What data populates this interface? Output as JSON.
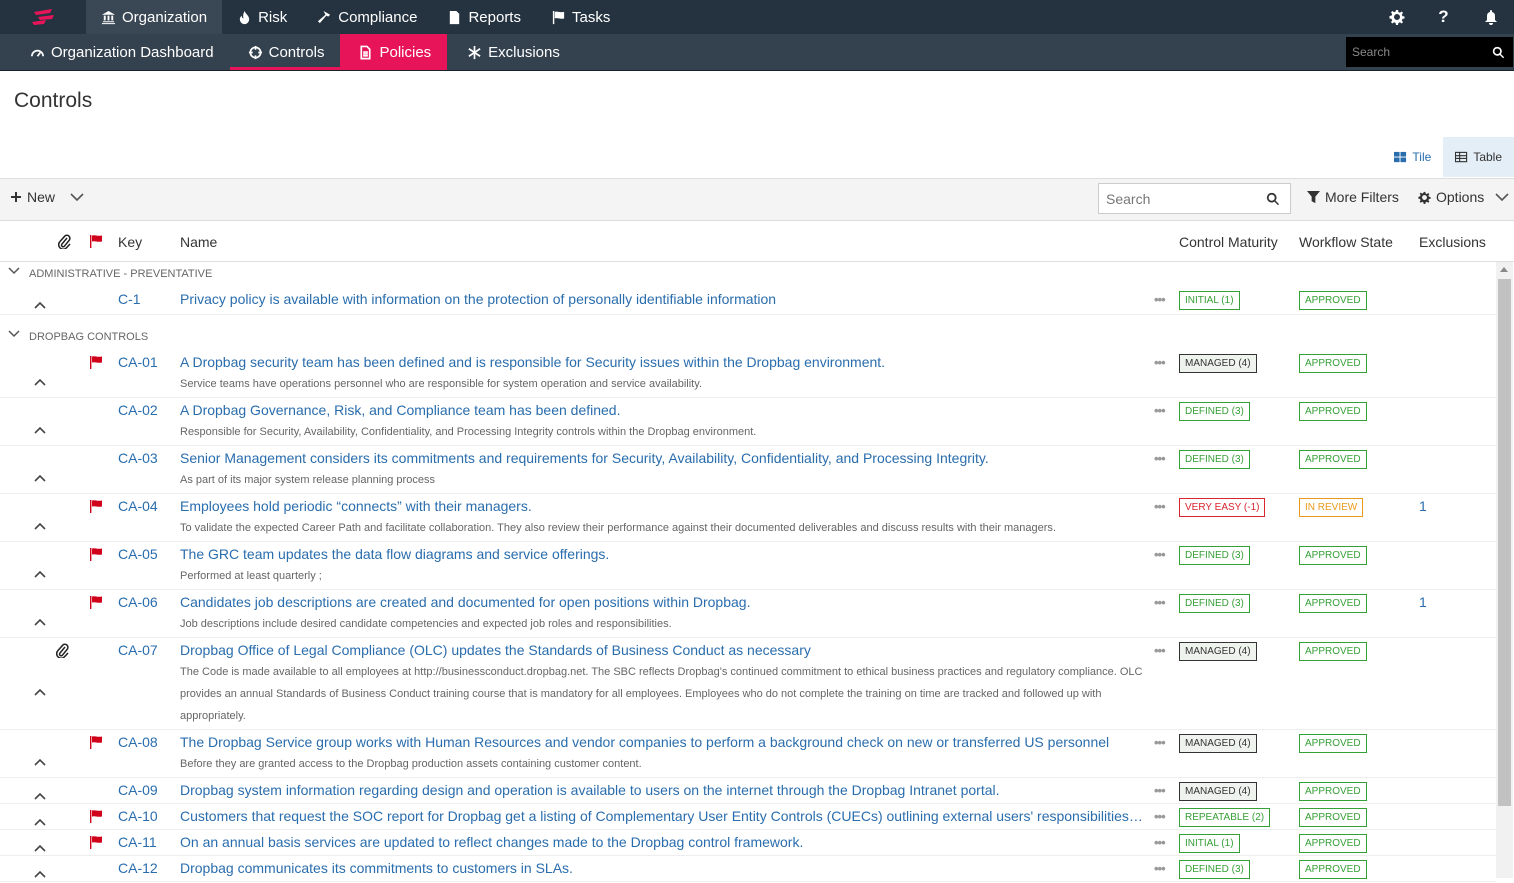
{
  "top_nav": {
    "items": [
      {
        "label": "Organization",
        "icon": "building-icon",
        "active": true
      },
      {
        "label": "Risk",
        "icon": "fire-icon"
      },
      {
        "label": "Compliance",
        "icon": "hammer-icon"
      },
      {
        "label": "Reports",
        "icon": "document-icon"
      },
      {
        "label": "Tasks",
        "icon": "flag-icon"
      }
    ],
    "right_icons": [
      "gear-icon",
      "help-icon",
      "bell-icon"
    ],
    "help_glyph": "?"
  },
  "sub_nav": {
    "items": [
      {
        "label": "Organization Dashboard",
        "icon": "dashboard-icon"
      },
      {
        "label": "Controls",
        "icon": "crosshair-icon",
        "active": true
      },
      {
        "label": "Policies",
        "icon": "file-icon",
        "highlight": true
      },
      {
        "label": "Exclusions",
        "icon": "asterisk-icon"
      }
    ],
    "search_placeholder": "Search"
  },
  "page": {
    "title": "Controls"
  },
  "view_toggle": {
    "tile_label": "Tile",
    "table_label": "Table",
    "selected": "Table"
  },
  "toolbar": {
    "new_label": "New",
    "search_placeholder": "Search",
    "more_filters_label": "More Filters",
    "options_label": "Options"
  },
  "table": {
    "headers": {
      "key": "Key",
      "name": "Name",
      "maturity": "Control Maturity",
      "workflow": "Workflow State",
      "exclusions": "Exclusions"
    },
    "groups": [
      {
        "label": "ADMINISTRATIVE - PREVENTATIVE",
        "rows": [
          {
            "key": "C-1",
            "name": "Privacy policy is available with information on the protection of personally identifiable information",
            "desc": "",
            "maturity": "INITIAL (1)",
            "maturity_style": "green",
            "workflow": "APPROVED",
            "workflow_style": "green",
            "exclusions": "",
            "flag": false,
            "clip": false
          }
        ]
      },
      {
        "label": "DROPBAG CONTROLS",
        "rows": [
          {
            "key": "CA-01",
            "name": "A Dropbag security team has been defined and is responsible for Security issues within the Dropbag environment.",
            "desc": "Service teams have operations personnel who are responsible for system operation and service availability.",
            "maturity": "MANAGED (4)",
            "maturity_style": "dark",
            "workflow": "APPROVED",
            "workflow_style": "green",
            "exclusions": "",
            "flag": true,
            "clip": false
          },
          {
            "key": "CA-02",
            "name": "A Dropbag Governance, Risk, and Compliance team has been defined.",
            "desc": "Responsible for Security, Availability, Confidentiality, and Processing Integrity controls within the Dropbag environment.",
            "maturity": "DEFINED (3)",
            "maturity_style": "green",
            "workflow": "APPROVED",
            "workflow_style": "green",
            "exclusions": "",
            "flag": false,
            "clip": false
          },
          {
            "key": "CA-03",
            "name": "Senior Management considers its commitments and requirements for Security, Availability, Confidentiality, and Processing Integrity.",
            "desc": "As part of its major system release planning process",
            "maturity": "DEFINED (3)",
            "maturity_style": "green",
            "workflow": "APPROVED",
            "workflow_style": "green",
            "exclusions": "",
            "flag": false,
            "clip": false
          },
          {
            "key": "CA-04",
            "name": "Employees hold periodic “connects” with their managers.",
            "desc": "To validate the expected Career Path and facilitate collaboration. They also review their performance against their documented deliverables and discuss results with their managers.",
            "maturity": "VERY EASY (-1)",
            "maturity_style": "red",
            "workflow": "IN REVIEW",
            "workflow_style": "orange",
            "exclusions": "1",
            "flag": true,
            "clip": false
          },
          {
            "key": "CA-05",
            "name": "The GRC team updates the data flow diagrams and service offerings.",
            "desc": "Performed at least quarterly ;",
            "maturity": "DEFINED (3)",
            "maturity_style": "green",
            "workflow": "APPROVED",
            "workflow_style": "green",
            "exclusions": "",
            "flag": true,
            "clip": false
          },
          {
            "key": "CA-06",
            "name": "Candidates job descriptions are created and documented for open positions within Dropbag.",
            "desc": "Job descriptions include desired candidate competencies and expected job roles and responsibilities.",
            "maturity": "DEFINED (3)",
            "maturity_style": "green",
            "workflow": "APPROVED",
            "workflow_style": "green",
            "exclusions": "1",
            "flag": true,
            "clip": false
          },
          {
            "key": "CA-07",
            "name": "Dropbag Office of Legal Compliance (OLC) updates the Standards of Business Conduct as necessary",
            "desc": "The Code is made available to all employees at http://businessconduct.dropbag.net. The SBC reflects Dropbag's continued commitment to ethical business practices and regulatory compliance. OLC provides an annual Standards of Business Conduct training course that is mandatory for all employees. Employees who do not complete the training on time are tracked and followed up with appropriately.",
            "maturity": "MANAGED (4)",
            "maturity_style": "dark",
            "workflow": "APPROVED",
            "workflow_style": "green",
            "exclusions": "",
            "flag": false,
            "clip": true
          },
          {
            "key": "CA-08",
            "name": "The Dropbag Service group works with Human Resources and vendor companies to perform a background check on new or transferred US personnel",
            "desc": "Before they are granted access to the Dropbag production assets containing customer content.",
            "maturity": "MANAGED (4)",
            "maturity_style": "dark",
            "workflow": "APPROVED",
            "workflow_style": "green",
            "exclusions": "",
            "flag": true,
            "clip": false
          },
          {
            "key": "CA-09",
            "name": "Dropbag system information regarding design and operation is available to users on the internet through the Dropbag Intranet portal.",
            "desc": "",
            "maturity": "MANAGED (4)",
            "maturity_style": "dark",
            "workflow": "APPROVED",
            "workflow_style": "green",
            "exclusions": "",
            "flag": false,
            "clip": false
          },
          {
            "key": "CA-10",
            "name": "Customers that request the SOC report for Dropbag get a listing of Complementary User Entity Controls (CUECs) outlining external users' responsibilities for syste...",
            "desc": "",
            "maturity": "REPEATABLE (2)",
            "maturity_style": "green",
            "workflow": "APPROVED",
            "workflow_style": "green",
            "exclusions": "",
            "flag": true,
            "clip": false
          },
          {
            "key": "CA-11",
            "name": "On an annual basis services are updated to reflect changes made to the Dropbag control framework.",
            "desc": "",
            "maturity": "INITIAL (1)",
            "maturity_style": "green",
            "workflow": "APPROVED",
            "workflow_style": "green",
            "exclusions": "",
            "flag": true,
            "clip": false
          },
          {
            "key": "CA-12",
            "name": "Dropbag communicates its commitments to customers in SLAs.",
            "desc": "",
            "maturity": "DEFINED (3)",
            "maturity_style": "green",
            "workflow": "APPROVED",
            "workflow_style": "green",
            "exclusions": "",
            "flag": false,
            "clip": false
          }
        ]
      }
    ]
  }
}
